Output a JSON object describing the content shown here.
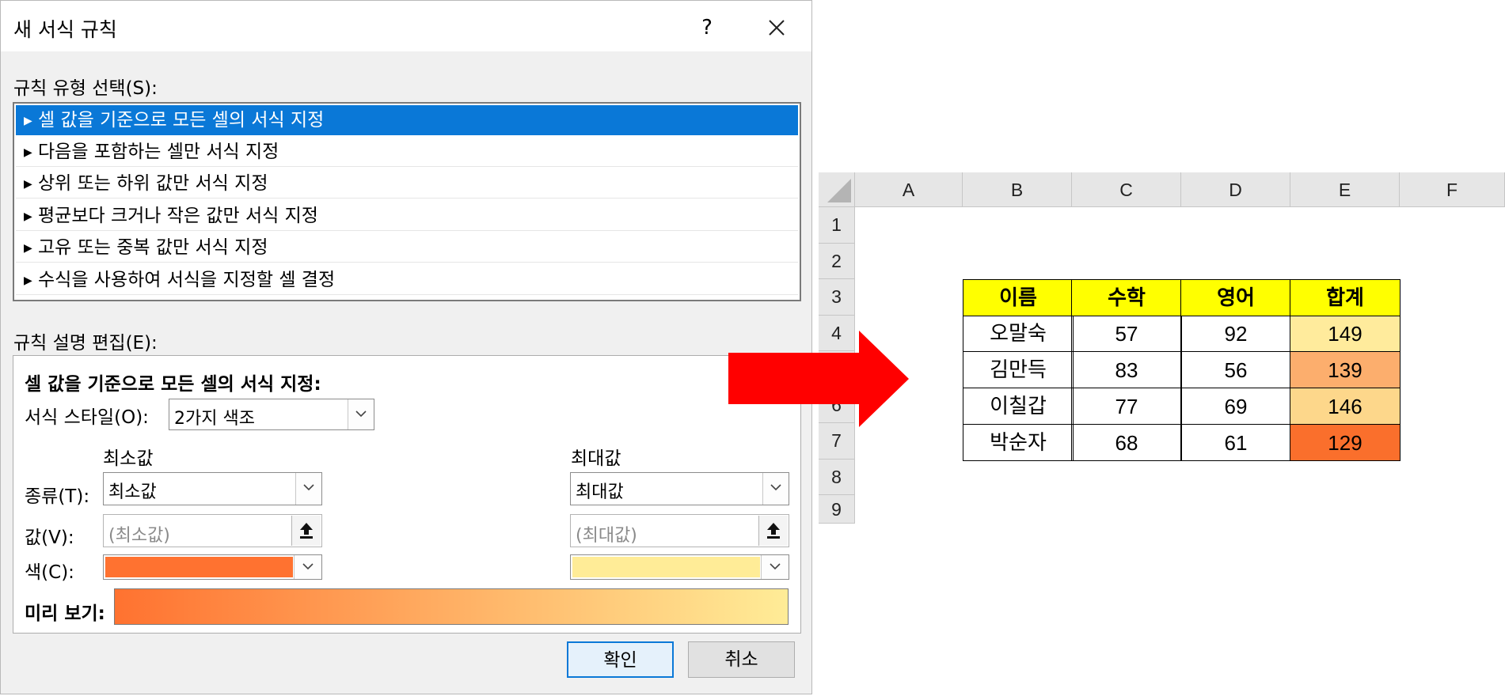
{
  "dialog": {
    "title": "새 서식 규칙",
    "help": "?",
    "rule_type_label": "규칙 유형 선택(S):",
    "rule_types": [
      "셀 값을 기준으로 모든 셀의 서식 지정",
      "다음을 포함하는 셀만 서식 지정",
      "상위 또는 하위 값만 서식 지정",
      "평균보다 크거나 작은 값만 서식 지정",
      "고유 또는 중복 값만 서식 지정",
      "수식을 사용하여 서식을 지정할 셀 결정"
    ],
    "selected_rule_index": 0,
    "edit_label": "규칙 설명 편집(E):",
    "edit_heading": "셀 값을 기준으로 모든 셀의 서식 지정:",
    "format_style_label": "서식 스타일(O):",
    "format_style_value": "2가지 색조",
    "min_header": "최소값",
    "max_header": "최대값",
    "type_label": "종류(T):",
    "value_label": "값(V):",
    "color_label": "색(C):",
    "min_type": "최소값",
    "max_type": "최대값",
    "min_value_placeholder": "(최소값)",
    "max_value_placeholder": "(최대값)",
    "min_color": "#ff7230",
    "max_color": "#ffec97",
    "preview_label": "미리 보기:",
    "ok": "확인",
    "cancel": "취소"
  },
  "sheet": {
    "columns": [
      "A",
      "B",
      "C",
      "D",
      "E",
      "F"
    ],
    "rows": [
      "1",
      "2",
      "3",
      "4",
      "5",
      "6",
      "7",
      "8",
      "9"
    ],
    "table_header": [
      "이름",
      "수학",
      "영어",
      "합계"
    ],
    "table_rows": [
      {
        "name": "오말숙",
        "math": "57",
        "english": "92",
        "total": "149",
        "fill": "#ffeb9c"
      },
      {
        "name": "김만득",
        "math": "83",
        "english": "56",
        "total": "139",
        "fill": "#fcae6d"
      },
      {
        "name": "이칠갑",
        "math": "77",
        "english": "69",
        "total": "146",
        "fill": "#fdd78b"
      },
      {
        "name": "박순자",
        "math": "68",
        "english": "61",
        "total": "129",
        "fill": "#fa6f2c"
      }
    ],
    "header_fill": "#ffff00"
  },
  "arrow_color": "#ff0000"
}
